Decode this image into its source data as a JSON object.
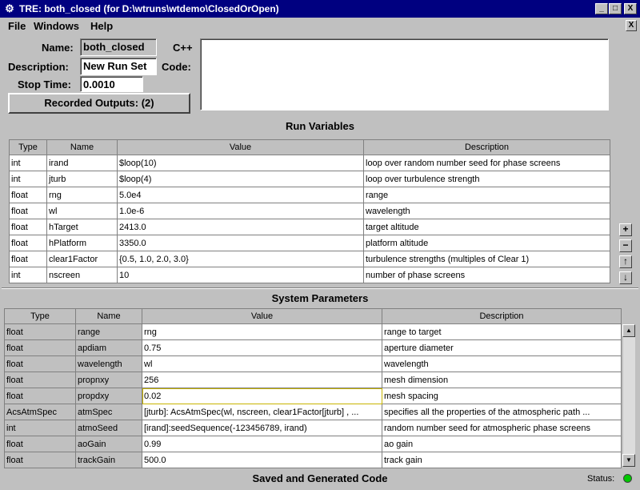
{
  "window": {
    "title": "TRE:  both_closed (for D:\\wtruns\\wtdemo\\ClosedOrOpen)",
    "minimize_glyph": "_",
    "maximize_glyph": "□",
    "close_glyph": "X"
  },
  "menubar": {
    "items": [
      "File",
      "Windows",
      "Help"
    ],
    "close_glyph": "X"
  },
  "form": {
    "name_label": "Name:",
    "name_value": "both_closed",
    "description_label": "Description:",
    "description_value": "New Run Set",
    "stop_time_label": "Stop Time:",
    "stop_time_value": "0.0010",
    "recorded_outputs_label": "Recorded Outputs: (2)",
    "cpp_label": "C++",
    "code_label": "Code:",
    "code_value": ""
  },
  "run_variables": {
    "title": "Run Variables",
    "columns": [
      "Type",
      "Name",
      "Value",
      "Description"
    ],
    "rows": [
      [
        "int",
        "irand",
        "$loop(10)",
        "loop over random number seed for phase screens"
      ],
      [
        "int",
        "jturb",
        "$loop(4)",
        "loop over turbulence strength"
      ],
      [
        "float",
        "rng",
        "5.0e4",
        "range"
      ],
      [
        "float",
        "wl",
        "1.0e-6",
        "wavelength"
      ],
      [
        "float",
        "hTarget",
        "2413.0",
        "target altitude"
      ],
      [
        "float",
        "hPlatform",
        "3350.0",
        "platform altitude"
      ],
      [
        "float",
        "clear1Factor",
        "{0.5, 1.0, 2.0, 3.0}",
        "turbulence strengths (multiples of Clear 1)"
      ],
      [
        "int",
        "nscreen",
        "10",
        "number of phase screens"
      ]
    ],
    "buttons": {
      "add": "+",
      "remove": "−",
      "up": "↑",
      "down": "↓"
    }
  },
  "system_parameters": {
    "title": "System Parameters",
    "columns": [
      "Type",
      "Name",
      "Value",
      "Description"
    ],
    "rows": [
      [
        "float",
        "range",
        "rng",
        "range to target"
      ],
      [
        "float",
        "apdiam",
        "0.75",
        "aperture diameter"
      ],
      [
        "float",
        "wavelength",
        "wl",
        "wavelength"
      ],
      [
        "float",
        "propnxy",
        "256",
        "mesh dimension"
      ],
      [
        "float",
        "propdxy",
        "0.02",
        "mesh spacing"
      ],
      [
        "AcsAtmSpec",
        "atmSpec",
        "[jturb]: AcsAtmSpec(wl, nscreen, clear1Factor[jturb] , ...",
        "specifies all the properties of  the atmospheric path ..."
      ],
      [
        "int",
        "atmoSeed",
        "[irand]:seedSequence(-123456789, irand)",
        "random number seed for atmospheric phase screens"
      ],
      [
        "float",
        "aoGain",
        "0.99",
        "ao gain"
      ],
      [
        "float",
        "trackGain",
        "500.0",
        "track gain"
      ]
    ],
    "selected_cell": "propdxy"
  },
  "footer": {
    "title": "Saved and Generated Code",
    "status_label": "Status:",
    "status_color": "#00c800"
  },
  "colors": {
    "titlebar": "#000080",
    "chrome": "#c0c0c0",
    "selection_outline": "#c8b400"
  }
}
